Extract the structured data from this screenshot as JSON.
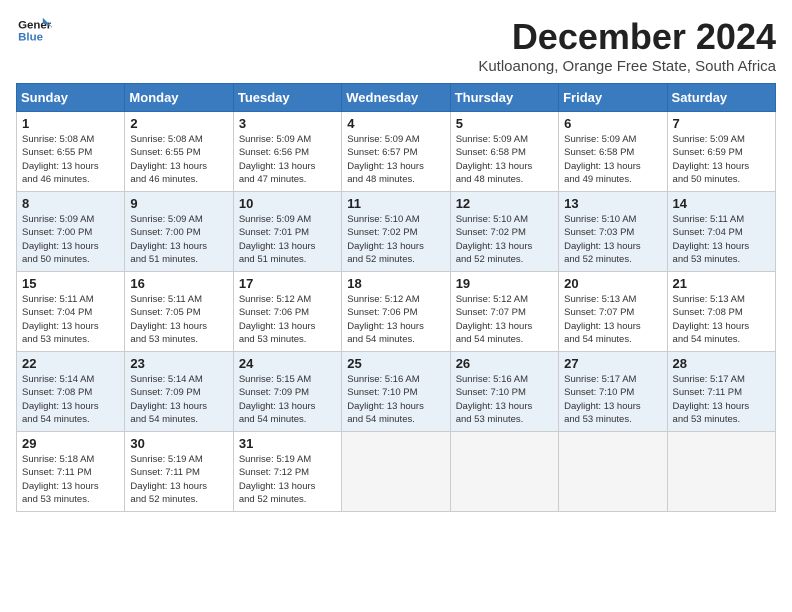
{
  "logo": {
    "line1": "General",
    "line2": "Blue"
  },
  "title": "December 2024",
  "subtitle": "Kutloanong, Orange Free State, South Africa",
  "days_of_week": [
    "Sunday",
    "Monday",
    "Tuesday",
    "Wednesday",
    "Thursday",
    "Friday",
    "Saturday"
  ],
  "weeks": [
    [
      {
        "day": "1",
        "info": "Sunrise: 5:08 AM\nSunset: 6:55 PM\nDaylight: 13 hours\nand 46 minutes."
      },
      {
        "day": "2",
        "info": "Sunrise: 5:08 AM\nSunset: 6:55 PM\nDaylight: 13 hours\nand 46 minutes."
      },
      {
        "day": "3",
        "info": "Sunrise: 5:09 AM\nSunset: 6:56 PM\nDaylight: 13 hours\nand 47 minutes."
      },
      {
        "day": "4",
        "info": "Sunrise: 5:09 AM\nSunset: 6:57 PM\nDaylight: 13 hours\nand 48 minutes."
      },
      {
        "day": "5",
        "info": "Sunrise: 5:09 AM\nSunset: 6:58 PM\nDaylight: 13 hours\nand 48 minutes."
      },
      {
        "day": "6",
        "info": "Sunrise: 5:09 AM\nSunset: 6:58 PM\nDaylight: 13 hours\nand 49 minutes."
      },
      {
        "day": "7",
        "info": "Sunrise: 5:09 AM\nSunset: 6:59 PM\nDaylight: 13 hours\nand 50 minutes."
      }
    ],
    [
      {
        "day": "8",
        "info": "Sunrise: 5:09 AM\nSunset: 7:00 PM\nDaylight: 13 hours\nand 50 minutes."
      },
      {
        "day": "9",
        "info": "Sunrise: 5:09 AM\nSunset: 7:00 PM\nDaylight: 13 hours\nand 51 minutes."
      },
      {
        "day": "10",
        "info": "Sunrise: 5:09 AM\nSunset: 7:01 PM\nDaylight: 13 hours\nand 51 minutes."
      },
      {
        "day": "11",
        "info": "Sunrise: 5:10 AM\nSunset: 7:02 PM\nDaylight: 13 hours\nand 52 minutes."
      },
      {
        "day": "12",
        "info": "Sunrise: 5:10 AM\nSunset: 7:02 PM\nDaylight: 13 hours\nand 52 minutes."
      },
      {
        "day": "13",
        "info": "Sunrise: 5:10 AM\nSunset: 7:03 PM\nDaylight: 13 hours\nand 52 minutes."
      },
      {
        "day": "14",
        "info": "Sunrise: 5:11 AM\nSunset: 7:04 PM\nDaylight: 13 hours\nand 53 minutes."
      }
    ],
    [
      {
        "day": "15",
        "info": "Sunrise: 5:11 AM\nSunset: 7:04 PM\nDaylight: 13 hours\nand 53 minutes."
      },
      {
        "day": "16",
        "info": "Sunrise: 5:11 AM\nSunset: 7:05 PM\nDaylight: 13 hours\nand 53 minutes."
      },
      {
        "day": "17",
        "info": "Sunrise: 5:12 AM\nSunset: 7:06 PM\nDaylight: 13 hours\nand 53 minutes."
      },
      {
        "day": "18",
        "info": "Sunrise: 5:12 AM\nSunset: 7:06 PM\nDaylight: 13 hours\nand 54 minutes."
      },
      {
        "day": "19",
        "info": "Sunrise: 5:12 AM\nSunset: 7:07 PM\nDaylight: 13 hours\nand 54 minutes."
      },
      {
        "day": "20",
        "info": "Sunrise: 5:13 AM\nSunset: 7:07 PM\nDaylight: 13 hours\nand 54 minutes."
      },
      {
        "day": "21",
        "info": "Sunrise: 5:13 AM\nSunset: 7:08 PM\nDaylight: 13 hours\nand 54 minutes."
      }
    ],
    [
      {
        "day": "22",
        "info": "Sunrise: 5:14 AM\nSunset: 7:08 PM\nDaylight: 13 hours\nand 54 minutes."
      },
      {
        "day": "23",
        "info": "Sunrise: 5:14 AM\nSunset: 7:09 PM\nDaylight: 13 hours\nand 54 minutes."
      },
      {
        "day": "24",
        "info": "Sunrise: 5:15 AM\nSunset: 7:09 PM\nDaylight: 13 hours\nand 54 minutes."
      },
      {
        "day": "25",
        "info": "Sunrise: 5:16 AM\nSunset: 7:10 PM\nDaylight: 13 hours\nand 54 minutes."
      },
      {
        "day": "26",
        "info": "Sunrise: 5:16 AM\nSunset: 7:10 PM\nDaylight: 13 hours\nand 53 minutes."
      },
      {
        "day": "27",
        "info": "Sunrise: 5:17 AM\nSunset: 7:10 PM\nDaylight: 13 hours\nand 53 minutes."
      },
      {
        "day": "28",
        "info": "Sunrise: 5:17 AM\nSunset: 7:11 PM\nDaylight: 13 hours\nand 53 minutes."
      }
    ],
    [
      {
        "day": "29",
        "info": "Sunrise: 5:18 AM\nSunset: 7:11 PM\nDaylight: 13 hours\nand 53 minutes."
      },
      {
        "day": "30",
        "info": "Sunrise: 5:19 AM\nSunset: 7:11 PM\nDaylight: 13 hours\nand 52 minutes."
      },
      {
        "day": "31",
        "info": "Sunrise: 5:19 AM\nSunset: 7:12 PM\nDaylight: 13 hours\nand 52 minutes."
      },
      null,
      null,
      null,
      null
    ]
  ]
}
